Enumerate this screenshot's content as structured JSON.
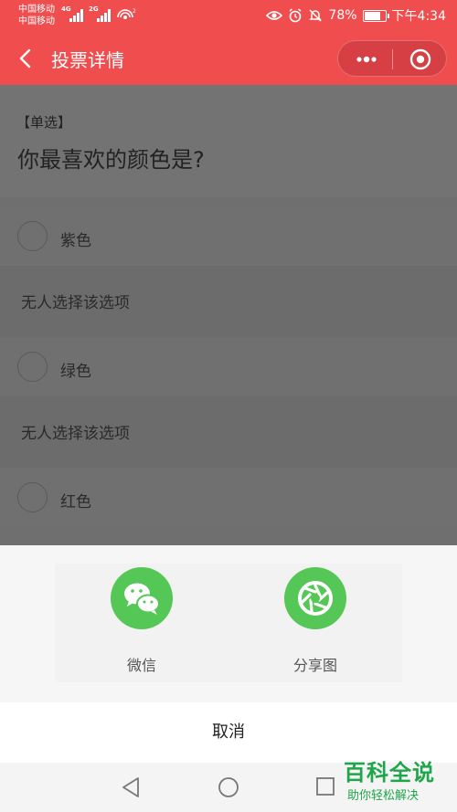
{
  "status": {
    "carrier1": "中国移动",
    "carrier2": "中国移动",
    "net1": "4G",
    "net2": "2G",
    "battery": "78%",
    "time": "下午4:34",
    "battery_level": 0.78
  },
  "nav": {
    "title": "投票详情"
  },
  "question": {
    "type": "【单选】",
    "text": "你最喜欢的颜色是?"
  },
  "options": [
    {
      "label": "紫色",
      "note": "无人选择该选项"
    },
    {
      "label": "绿色",
      "note": "无人选择该选项"
    },
    {
      "label": "红色"
    }
  ],
  "share": {
    "wechat_label": "微信",
    "image_label": "分享图",
    "cancel_label": "取消"
  },
  "watermark": {
    "title": "百科全说",
    "subtitle": "助你轻松解决"
  },
  "colors": {
    "header": "#f04d4f",
    "share_green": "#54c756",
    "watermark": "#1fa64a"
  }
}
